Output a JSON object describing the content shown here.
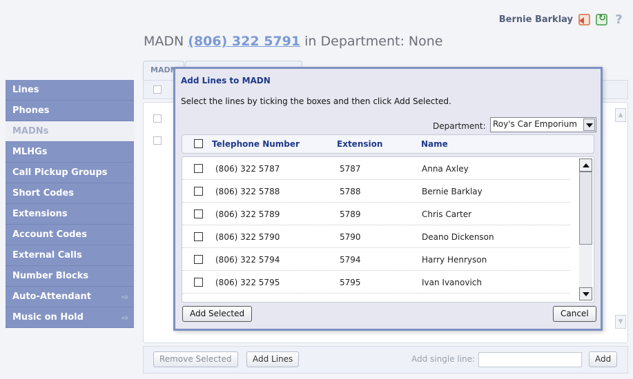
{
  "header": {
    "user_name": "Bernie Barklay",
    "title_prefix": "MADN ",
    "madn_number": "(806) 322 5791",
    "title_suffix": " in Department: None",
    "tab1": "MADN",
    "icons": [
      "logout-icon",
      "refresh-icon",
      "help-icon"
    ]
  },
  "sidebar": {
    "items": [
      {
        "label": "Lines"
      },
      {
        "label": "Phones"
      },
      {
        "label": "MADNs"
      },
      {
        "label": "MLHGs"
      },
      {
        "label": "Call Pickup Groups"
      },
      {
        "label": "Short Codes"
      },
      {
        "label": "Extensions"
      },
      {
        "label": "Account Codes"
      },
      {
        "label": "External Calls"
      },
      {
        "label": "Number Blocks"
      },
      {
        "label": "Auto-Attendant"
      },
      {
        "label": "Music on Hold"
      }
    ],
    "active": "MADNs"
  },
  "bottom_bar": {
    "remove_selected": "Remove Selected",
    "add_lines": "Add Lines",
    "single_line_label": "Add single line:",
    "single_line_value": "",
    "add": "Add"
  },
  "dialog": {
    "title": "Add Lines to MADN",
    "instructions": "Select the lines by ticking the boxes and then click Add Selected.",
    "department_label": "Department:",
    "department_value": "Roy's Car Emporium",
    "columns": {
      "telephone": "Telephone Number",
      "extension": "Extension",
      "name": "Name"
    },
    "rows": [
      {
        "telephone": "(806) 322 5787",
        "extension": "5787",
        "name": "Anna Axley",
        "checked": false
      },
      {
        "telephone": "(806) 322 5788",
        "extension": "5788",
        "name": "Bernie Barklay",
        "checked": false
      },
      {
        "telephone": "(806) 322 5789",
        "extension": "5789",
        "name": "Chris Carter",
        "checked": false
      },
      {
        "telephone": "(806) 322 5790",
        "extension": "5790",
        "name": "Deano Dickenson",
        "checked": false
      },
      {
        "telephone": "(806) 322 5794",
        "extension": "5794",
        "name": "Harry Henryson",
        "checked": false
      },
      {
        "telephone": "(806) 322 5795",
        "extension": "5795",
        "name": "Ivan Ivanovich",
        "checked": false
      }
    ],
    "add_selected": "Add Selected",
    "cancel": "Cancel"
  },
  "colors": {
    "sidebar": "#8494c4",
    "dialog_border": "#7d8fc2",
    "title_blue": "#1f3a8a",
    "link": "#7a9ad4"
  }
}
